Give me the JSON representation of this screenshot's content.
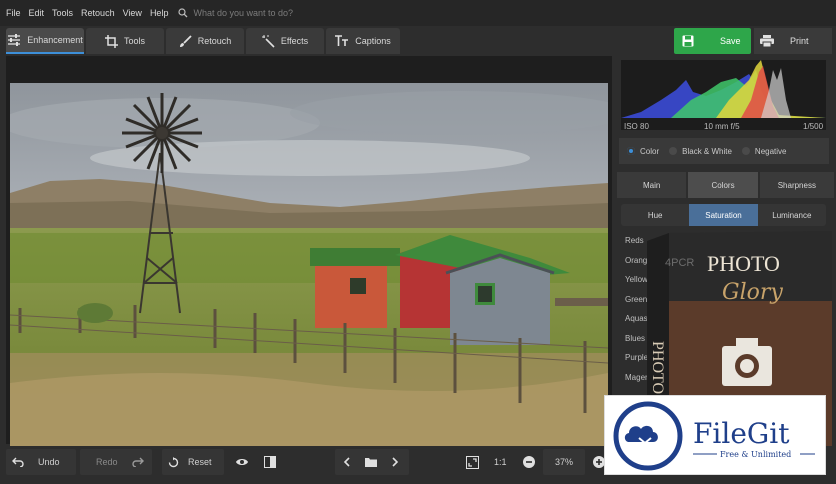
{
  "menu": {
    "items": [
      "File",
      "Edit",
      "Tools",
      "Retouch",
      "View",
      "Help"
    ],
    "search_placeholder": "What do you want to do?"
  },
  "tabs": [
    {
      "label": "Enhancement",
      "icon": "sliders-icon"
    },
    {
      "label": "Tools",
      "icon": "crop-icon"
    },
    {
      "label": "Retouch",
      "icon": "brush-icon"
    },
    {
      "label": "Effects",
      "icon": "magic-wand-icon"
    },
    {
      "label": "Captions",
      "icon": "text-icon"
    }
  ],
  "actions": {
    "save_label": "Save",
    "print_label": "Print"
  },
  "histogram": {
    "iso": "ISO 80",
    "lens": "10 mm f/5",
    "shutter": "1/500"
  },
  "color_mode": {
    "options": [
      "Color",
      "Black & White",
      "Negative"
    ],
    "selected": "Color"
  },
  "panel_tabs": [
    "Main",
    "Colors",
    "Sharpness"
  ],
  "panel_tabs_active": "Colors",
  "color_modes": [
    "Hue",
    "Saturation",
    "Luminance"
  ],
  "color_modes_active": "Saturation",
  "color_channels": [
    "Reds",
    "Oranges",
    "Yellows",
    "Greens",
    "Aquas",
    "Blues",
    "Purples",
    "Magentas"
  ],
  "bottom": {
    "undo_label": "Undo",
    "redo_label": "Redo",
    "reset_label": "Reset",
    "ratio_label": "1:1",
    "zoom_value": "37%"
  },
  "promo": {
    "title_main": "PHOTO",
    "title_script": "Glory",
    "spine_text": "PHOTO",
    "watermark": "4PCR"
  },
  "watermark_badge": {
    "brand": "FileGit",
    "tagline": "Free & Unlimited"
  },
  "colors": {
    "accent": "#3d8fd8",
    "save": "#2ea64a",
    "panel": "#2d2d2d"
  }
}
